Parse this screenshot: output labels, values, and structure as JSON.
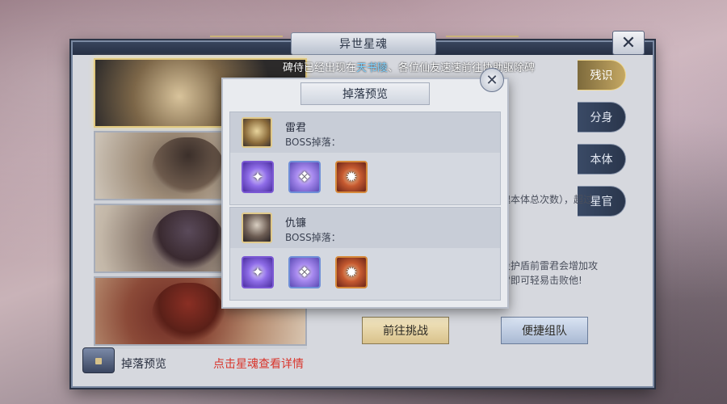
{
  "window": {
    "title": "异世星魂",
    "close_symbol": "✕"
  },
  "marquee": {
    "prefix": "碑侍已经出现在",
    "location": "天书陵",
    "suffix": "、各位仙友速速前往协助驱除碑"
  },
  "tabs": [
    {
      "label": "残识",
      "active": true
    },
    {
      "label": "分身",
      "active": false
    },
    {
      "label": "本体",
      "active": false
    },
    {
      "label": "星官",
      "active": false
    }
  ],
  "background_text": {
    "line1": "魂本体总次数），超过",
    "line2": "段护盾前雷君会增加攻",
    "line3": "雷即可轻易击败他!"
  },
  "buttons": {
    "challenge": "前往挑战",
    "team": "便捷组队"
  },
  "bottom": {
    "drop_preview_label": "掉落预览",
    "hint": "点击星魂查看详情"
  },
  "popup": {
    "title": "掉落预览",
    "close_symbol": "✕",
    "sections": [
      {
        "boss_name": "雷君",
        "drop_label": "BOSS掉落：",
        "items": [
          "purple-crystal-icon",
          "violet-feather-icon",
          "fire-beast-icon"
        ]
      },
      {
        "boss_name": "仇镰",
        "drop_label": "BOSS掉落：",
        "items": [
          "purple-crystal-icon",
          "violet-feather-icon",
          "fire-beast-icon"
        ]
      }
    ]
  },
  "colors": {
    "accent_gold": "#e1c97e",
    "hint_red": "#d9342b",
    "location_blue": "#7fd3ff"
  }
}
